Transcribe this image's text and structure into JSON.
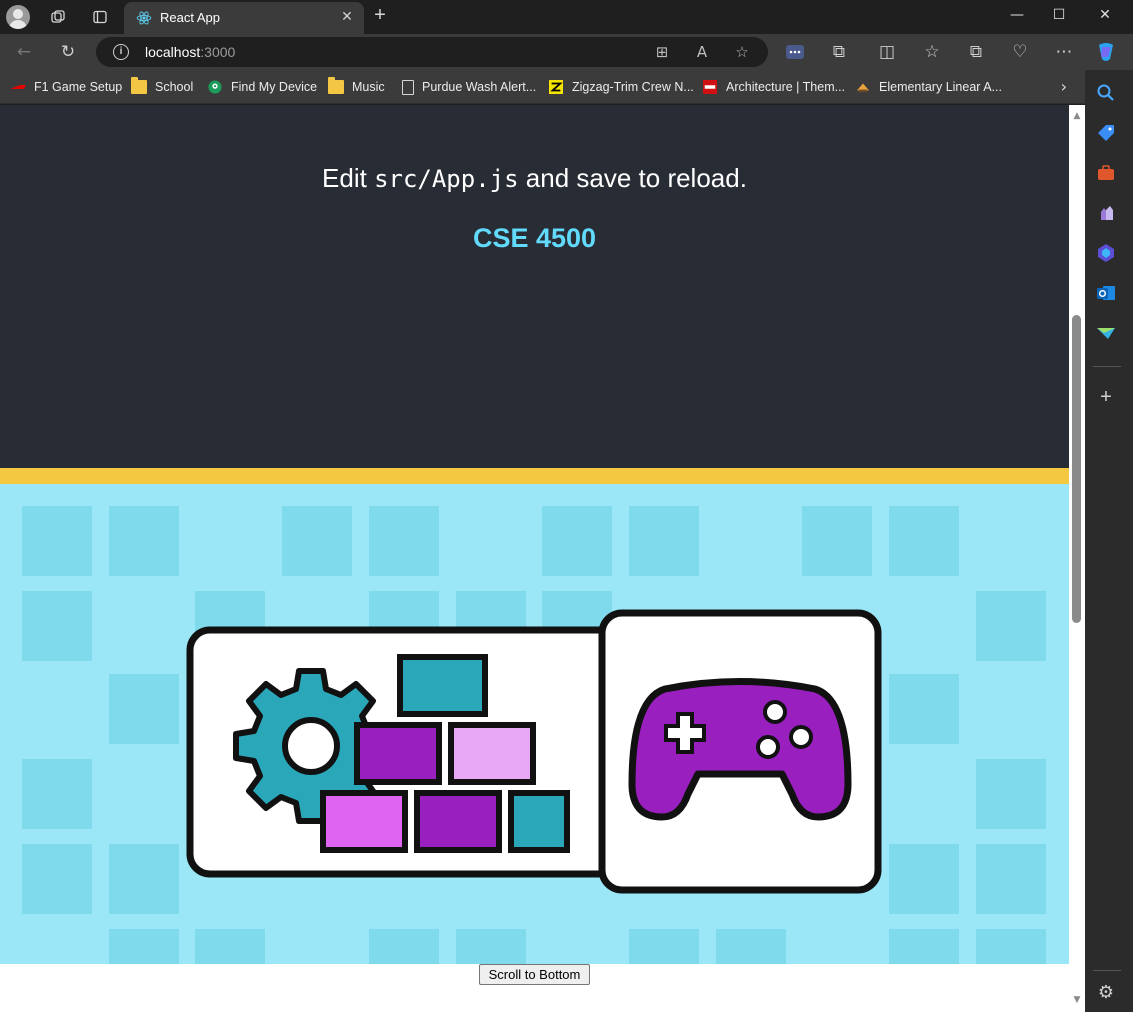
{
  "browser": {
    "tab": {
      "title": "React App"
    },
    "address": {
      "host": "localhost",
      "port": ":3000"
    },
    "bookmarks": [
      {
        "label": "F1 Game Setup",
        "icon": "f1-icon"
      },
      {
        "label": "School",
        "icon": "folder-icon"
      },
      {
        "label": "Find My Device",
        "icon": "find-device-icon"
      },
      {
        "label": "Music",
        "icon": "folder-icon"
      },
      {
        "label": "Purdue Wash Alert...",
        "icon": "page-icon"
      },
      {
        "label": "Zigzag-Trim Crew N...",
        "icon": "zigzag-icon"
      },
      {
        "label": "Architecture | Them...",
        "icon": "lego-icon"
      },
      {
        "label": "Elementary Linear A...",
        "icon": "book-icon"
      }
    ]
  },
  "page": {
    "edit_prefix": "Edit ",
    "edit_code": "src/App.js",
    "edit_suffix": " and save to reload.",
    "course": "CSE 4500",
    "scroll_button": "Scroll to Bottom",
    "colors": {
      "header_bg": "#282c34",
      "course_text": "#61dafb",
      "yellow_band": "#f5c842",
      "hero_bg": "#9be7f7"
    }
  }
}
